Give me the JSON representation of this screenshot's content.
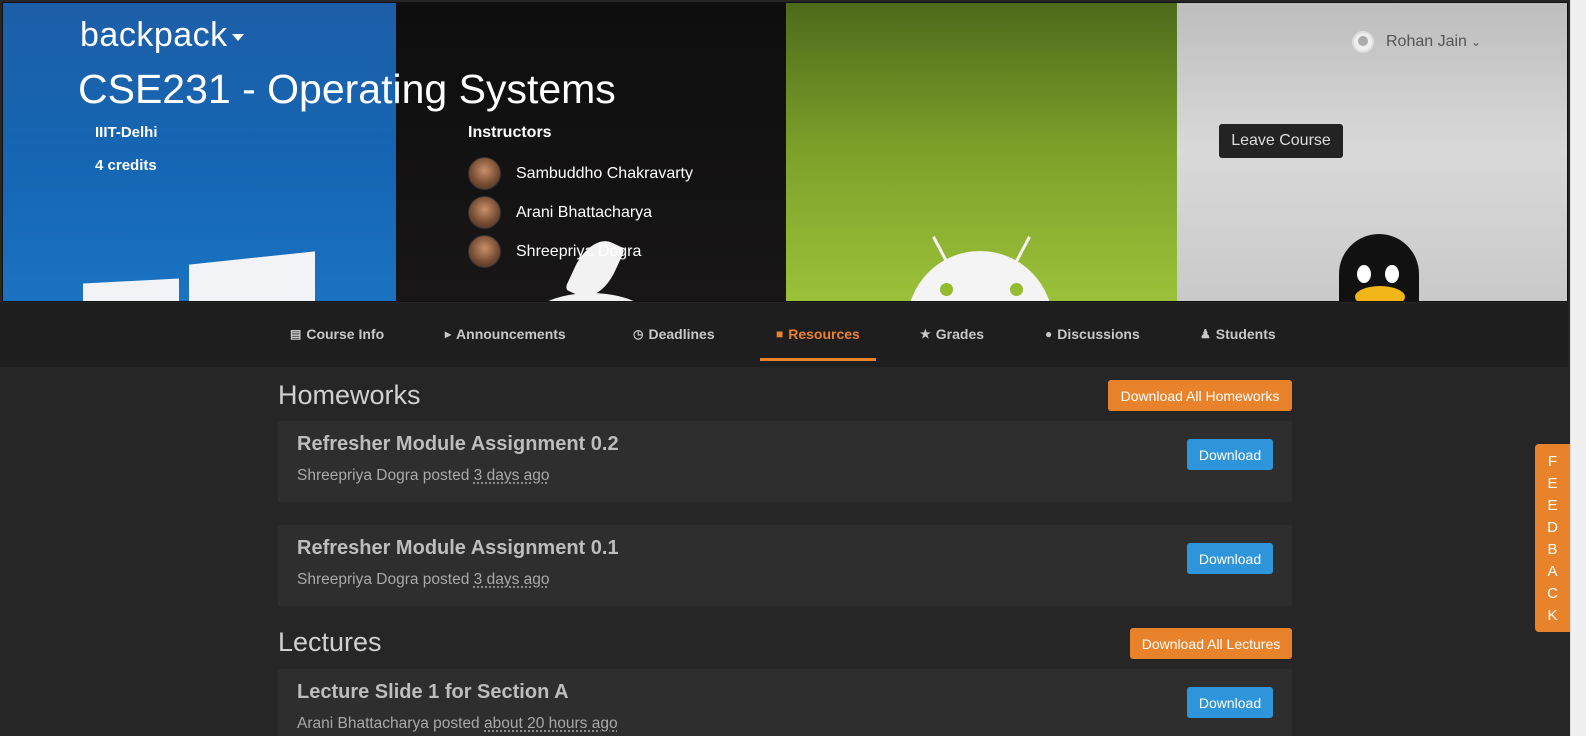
{
  "header": {
    "brand": "backpack",
    "course_title": "CSE231 - Operating Systems",
    "institute": "IIIT-Delhi",
    "credits": "4 credits",
    "instructors_heading": "Instructors",
    "instructors": [
      {
        "name": "Sambuddho Chakravarty"
      },
      {
        "name": "Arani Bhattacharya"
      },
      {
        "name": "Shreepriya Dogra"
      }
    ],
    "user_name": "Rohan Jain",
    "leave_button": "Leave Course"
  },
  "nav": {
    "tabs": [
      {
        "label": "Course Info",
        "icon": "list-icon"
      },
      {
        "label": "Announcements",
        "icon": "bullhorn-icon"
      },
      {
        "label": "Deadlines",
        "icon": "clock-icon"
      },
      {
        "label": "Resources",
        "icon": "book-icon",
        "active": true
      },
      {
        "label": "Grades",
        "icon": "star-icon"
      },
      {
        "label": "Discussions",
        "icon": "comment-icon"
      },
      {
        "label": "Students",
        "icon": "users-icon"
      }
    ]
  },
  "homeworks": {
    "title": "Homeworks",
    "download_all": "Download All Homeworks",
    "items": [
      {
        "title": "Refresher Module Assignment 0.2",
        "author": "Shreepriya Dogra",
        "posted": "posted",
        "time": "3 days ago",
        "button": "Download"
      },
      {
        "title": "Refresher Module Assignment 0.1",
        "author": "Shreepriya Dogra",
        "posted": "posted",
        "time": "3 days ago",
        "button": "Download"
      }
    ]
  },
  "lectures": {
    "title": "Lectures",
    "download_all": "Download All Lectures",
    "items": [
      {
        "title": "Lecture Slide 1 for Section A",
        "author": "Arani Bhattacharya",
        "posted": "posted",
        "time": "about 20 hours ago",
        "button": "Download"
      }
    ]
  },
  "feedback_letters": [
    "F",
    "E",
    "E",
    "D",
    "B",
    "A",
    "C",
    "K"
  ],
  "colors": {
    "accent": "#e8822b",
    "download_blue": "#2f95da",
    "background": "#262626"
  }
}
